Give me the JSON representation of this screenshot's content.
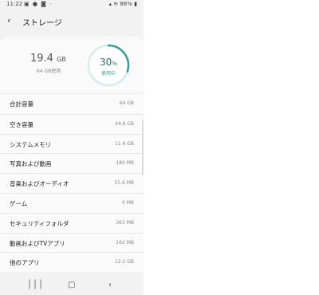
{
  "status_bar": {
    "time": "11:22",
    "notif_icons": "▣ ● ◙ ·",
    "battery": "86%"
  },
  "header": {
    "title": "ストレージ"
  },
  "summary": {
    "used_value": "19.4",
    "used_unit": "GB",
    "total_label": "64 GB使用",
    "percent": "30",
    "percent_sign": "%",
    "percent_label": "使用中",
    "ring_fraction": 0.3
  },
  "rows": [
    {
      "label": "合計容量",
      "value": "64 GB"
    },
    {
      "label": "空き容量",
      "value": "44.6 GB"
    },
    {
      "label": "システムメモリ",
      "value": "11.6 GB"
    },
    {
      "label": "写真および動画",
      "value": "180 MB"
    },
    {
      "label": "音楽およびオーディオ",
      "value": "55.6 MB"
    },
    {
      "label": "ゲーム",
      "value": "0 MB"
    },
    {
      "label": "セキュリティフォルダ",
      "value": "363 MB"
    },
    {
      "label": "動画およびTVアプリ",
      "value": "162 MB"
    },
    {
      "label": "他のアプリ",
      "value": "12.2 GB"
    }
  ],
  "nav": {
    "recent_icon": "recent-apps-icon",
    "home_icon": "home-icon",
    "back_icon": "back-icon"
  },
  "colors": {
    "accent": "#3a9b9b",
    "ring_track": "#d8ebeb"
  }
}
